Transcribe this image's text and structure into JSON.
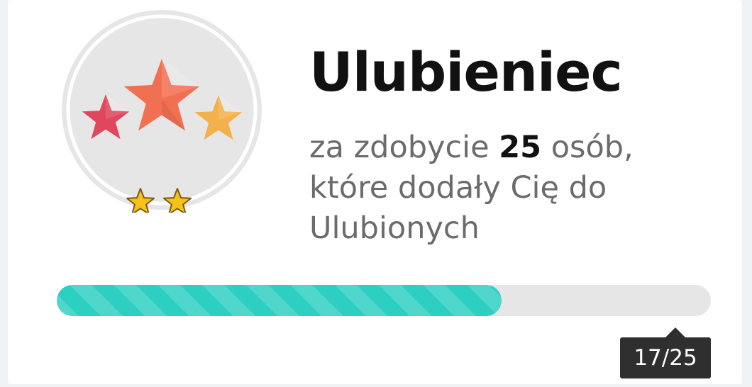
{
  "achievement": {
    "title": "Ulubieniec",
    "desc_prefix": "za zdobycie",
    "count": "25",
    "desc_suffix": "osób, które dodały Cię do Ulubionych",
    "level_stars": 2
  },
  "progress": {
    "current": 17,
    "target": 25,
    "label": "17/25"
  },
  "icons": {
    "badge": "three-stars-badge-icon",
    "level": "gold-star-icon"
  },
  "colors": {
    "progress_fill": "#2dcfc2",
    "progress_track": "#e6e6e6",
    "star_left": "#e0475f",
    "star_center": "#f27052",
    "star_right": "#f4b04a",
    "level_star": "#f6c21a",
    "tooltip_bg": "#2f2f2f"
  }
}
